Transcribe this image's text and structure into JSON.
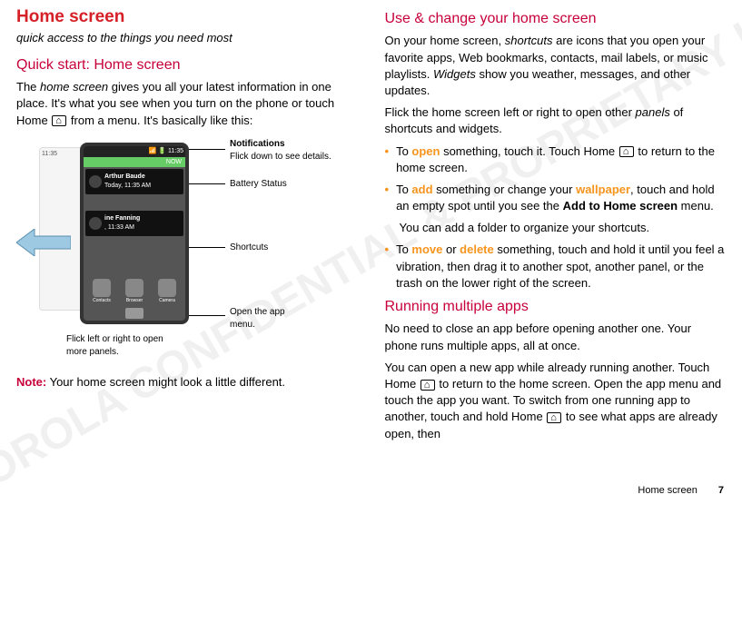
{
  "left": {
    "title": "Home screen",
    "subtitle": "quick access to the things you need most",
    "section": "Quick start: Home screen",
    "p1_a": "The ",
    "p1_em": "home screen",
    "p1_b": " gives you all your latest information in one place. It's what you see when you turn on the phone or touch Home ",
    "p1_c": " from a menu. It's basically like this:",
    "note_label": "Note:",
    "note_text": " Your home screen might look a little different."
  },
  "mock": {
    "ghost_time": "11:35",
    "status_time": "11:35",
    "now": "NOW",
    "contact1_name": "Arthur Baude",
    "contact1_sub": "Today, 11:35 AM",
    "contact2_name": "ine Fanning",
    "contact2_sub": ", 11:33 AM",
    "shortcuts": [
      "Contacts",
      "Browser",
      "Camera"
    ],
    "anno_notifications_t": "Notifications",
    "anno_notifications_s": "Flick down to see details.",
    "anno_battery": "Battery Status",
    "anno_shortcuts": "Shortcuts",
    "anno_appmenu": "Open the app menu.",
    "anno_flick": "Flick left or right to open more panels."
  },
  "right": {
    "section1": "Use & change your home screen",
    "r1_a": "On your home screen, ",
    "r1_em1": "shortcuts",
    "r1_b": " are icons that you open your favorite apps, Web bookmarks, contacts, mail labels, or music playlists. ",
    "r1_em2": "Widgets",
    "r1_c": " show you weather, messages, and other updates.",
    "r2_a": "Flick the home screen left or right to open other ",
    "r2_em": "panels",
    "r2_b": " of shortcuts and widgets.",
    "b1_a": "To ",
    "b1_open": "open",
    "b1_b": " something, touch it. Touch Home ",
    "b1_c": " to return to the home screen.",
    "b2_a": "To ",
    "b2_add": "add",
    "b2_b": " something or change your ",
    "b2_wall": "wallpaper",
    "b2_c": ", touch and hold an empty spot until you see the ",
    "b2_strong": "Add to Home screen",
    "b2_d": " menu.",
    "b2_extra": "You can add a folder to organize your shortcuts.",
    "b3_a": "To ",
    "b3_move": "move",
    "b3_b": " or ",
    "b3_del": "delete",
    "b3_c": " something, touch and hold it until you feel a vibration, then drag it to another spot, another panel, or the trash on the lower right of the screen.",
    "section2": "Running multiple apps",
    "r3": "No need to close an app before opening another one. Your phone runs multiple apps, all at once.",
    "r4_a": "You can open a new app while already running another. Touch Home ",
    "r4_b": " to return to the home screen. Open the app menu and touch the app you want. To switch from one running app to another, touch and hold Home ",
    "r4_c": " to see what apps are already open, then"
  },
  "footer": {
    "section": "Home screen",
    "page": "7"
  },
  "watermark": "DRAFT - MOTOROLA CONFIDENTIAL & PROPRIETARY INFORMATION"
}
